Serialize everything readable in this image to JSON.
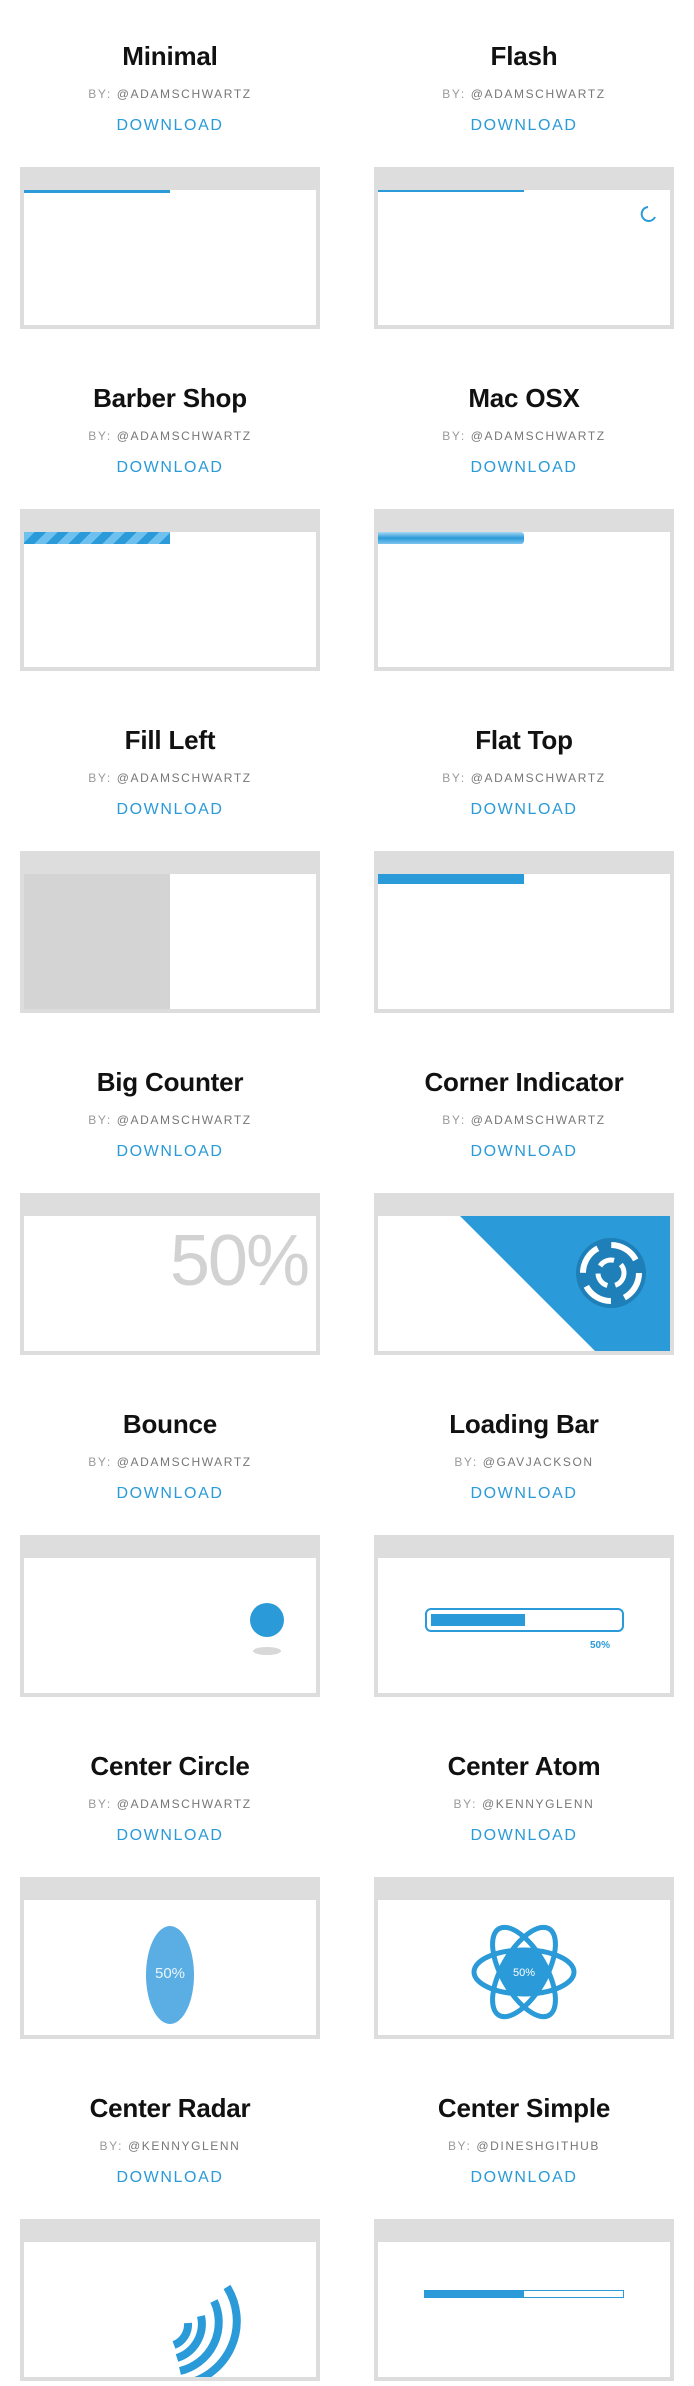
{
  "colors": {
    "accent": "#2a9ad8",
    "chrome": "#dddddd",
    "fill": "#d4d4d4"
  },
  "items": [
    {
      "title": "Minimal",
      "by": "BY:",
      "author": "@ADAMSCHWARTZ",
      "download": "DOWNLOAD",
      "progress": 0.5
    },
    {
      "title": "Flash",
      "by": "BY:",
      "author": "@ADAMSCHWARTZ",
      "download": "DOWNLOAD",
      "progress": 0.5
    },
    {
      "title": "Barber Shop",
      "by": "BY:",
      "author": "@ADAMSCHWARTZ",
      "download": "DOWNLOAD",
      "progress": 0.5
    },
    {
      "title": "Mac OSX",
      "by": "BY:",
      "author": "@ADAMSCHWARTZ",
      "download": "DOWNLOAD",
      "progress": 0.5
    },
    {
      "title": "Fill Left",
      "by": "BY:",
      "author": "@ADAMSCHWARTZ",
      "download": "DOWNLOAD",
      "progress": 0.5
    },
    {
      "title": "Flat Top",
      "by": "BY:",
      "author": "@ADAMSCHWARTZ",
      "download": "DOWNLOAD",
      "progress": 0.5
    },
    {
      "title": "Big Counter",
      "by": "BY:",
      "author": "@ADAMSCHWARTZ",
      "download": "DOWNLOAD",
      "progress": 0.5,
      "counter_text": "50%"
    },
    {
      "title": "Corner Indicator",
      "by": "BY:",
      "author": "@ADAMSCHWARTZ",
      "download": "DOWNLOAD",
      "progress": 0.5
    },
    {
      "title": "Bounce",
      "by": "BY:",
      "author": "@ADAMSCHWARTZ",
      "download": "DOWNLOAD"
    },
    {
      "title": "Loading Bar",
      "by": "BY:",
      "author": "@GAVJACKSON",
      "download": "DOWNLOAD",
      "progress": 0.5,
      "progress_text": "50%"
    },
    {
      "title": "Center Circle",
      "by": "BY:",
      "author": "@ADAMSCHWARTZ",
      "download": "DOWNLOAD",
      "progress": 0.5,
      "progress_text": "50%"
    },
    {
      "title": "Center Atom",
      "by": "BY:",
      "author": "@KENNYGLENN",
      "download": "DOWNLOAD",
      "progress": 0.5,
      "progress_text": "50%"
    },
    {
      "title": "Center Radar",
      "by": "BY:",
      "author": "@KENNYGLENN",
      "download": "DOWNLOAD"
    },
    {
      "title": "Center Simple",
      "by": "BY:",
      "author": "@DINESHGITHUB",
      "download": "DOWNLOAD",
      "progress": 0.5
    }
  ]
}
